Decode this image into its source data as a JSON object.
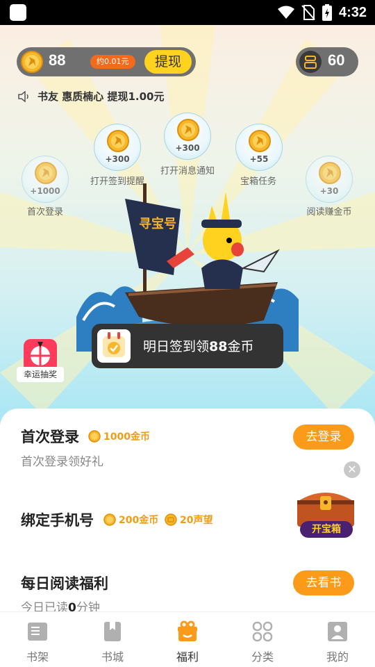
{
  "status_bar": {
    "time": "4:32"
  },
  "account": {
    "coins": "88",
    "coins_approx": "约0.01元",
    "withdraw_label": "提现",
    "reputation": "60"
  },
  "ticker": {
    "text": "书友 惠质楠心 提现1.00元"
  },
  "bubbles": [
    {
      "amount": "+1000",
      "label": "首次登录"
    },
    {
      "amount": "+300",
      "label": "打开签到提醒"
    },
    {
      "amount": "+300",
      "label": "打开消息通知"
    },
    {
      "amount": "+55",
      "label": "宝箱任务"
    },
    {
      "amount": "+30",
      "label": "阅读赚金币"
    }
  ],
  "ship": {
    "flag_text": "寻宝号"
  },
  "lottery": {
    "label": "幸运抽奖"
  },
  "toast": {
    "prefix": "明日签到领",
    "amount": "88",
    "suffix": "金币"
  },
  "tasks": [
    {
      "title": "首次登录",
      "rewards": [
        "1000金币"
      ],
      "subtitle": "首次登录领好礼",
      "button": "去登录"
    },
    {
      "title": "绑定手机号",
      "rewards": [
        "200金币",
        "20声望"
      ],
      "subtitle": "",
      "button": ""
    },
    {
      "title": "每日阅读福利",
      "rewards": [],
      "subtitle_prefix": "今日已读",
      "subtitle_value": "0",
      "subtitle_suffix": "分钟",
      "button": "去看书"
    }
  ],
  "treasure_chest": {
    "label": "开宝箱"
  },
  "tabs": [
    {
      "label": "书架",
      "icon": "bookshelf-icon",
      "active": false
    },
    {
      "label": "书城",
      "icon": "bookstore-icon",
      "active": false
    },
    {
      "label": "福利",
      "icon": "gift-icon",
      "active": true
    },
    {
      "label": "分类",
      "icon": "category-icon",
      "active": false
    },
    {
      "label": "我的",
      "icon": "profile-icon",
      "active": false
    }
  ],
  "colors": {
    "accent": "#fc9a1a",
    "coin": "#f7b72a",
    "active_tab": "#fc9a1a",
    "hero_bottom": "#a8e6f4"
  }
}
